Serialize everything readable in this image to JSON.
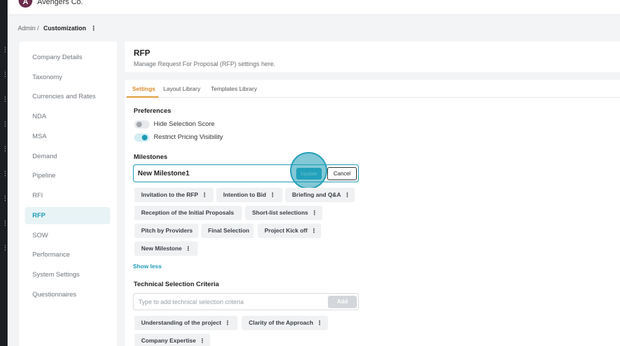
{
  "app": {
    "company_name": "Avengers Co.",
    "logo_letter": "A"
  },
  "breadcrumb": {
    "root": "Admin /",
    "current": "Customization",
    "menu_glyph": "⋮"
  },
  "sidebar": {
    "items": [
      {
        "label": "Company Details"
      },
      {
        "label": "Taxonomy"
      },
      {
        "label": "Currencies and Rates"
      },
      {
        "label": "NDA"
      },
      {
        "label": "MSA"
      },
      {
        "label": "Demand"
      },
      {
        "label": "Pipeline"
      },
      {
        "label": "RFI"
      },
      {
        "label": "RFP",
        "active": true
      },
      {
        "label": "SOW"
      },
      {
        "label": "Performance"
      },
      {
        "label": "System Settings"
      },
      {
        "label": "Questionnaires"
      }
    ]
  },
  "header": {
    "title": "RFP",
    "subtitle": "Manage Request For Proposal (RFP) settings here."
  },
  "tabs": [
    {
      "label": "Settings",
      "active": true
    },
    {
      "label": "Layout Library"
    },
    {
      "label": "Templates Library"
    }
  ],
  "preferences": {
    "title": "Preferences",
    "toggles": [
      {
        "label": "Hide Selection Score",
        "on": false
      },
      {
        "label": "Restrict Pricing Visibility",
        "on": true
      }
    ]
  },
  "milestones": {
    "title": "Milestones",
    "input_value": "New Milestone1",
    "update_label": "Update",
    "cancel_label": "Cancel",
    "chips": [
      "Invitation to the RFP",
      "Intention to Bid",
      "Briefing and Q&A",
      "Reception of the Initial Proposals",
      "Short-list selections",
      "Pitch by Providers",
      "Final Selection",
      "Project Kick off",
      "New Milestone"
    ],
    "show_less_label": "Show less"
  },
  "technical_criteria": {
    "title": "Technical Selection Criteria",
    "placeholder": "Type to add technical selection criteria",
    "add_label": "Add",
    "chips": [
      "Understanding of the project",
      "Clarity of the Approach",
      "Company Expertise"
    ]
  },
  "colors": {
    "accent": "#1b9bb4",
    "tab_accent": "#e09a3b",
    "rail": "#1b1f24"
  },
  "icons": {
    "chip_menu": "vertical-ellipsis-icon",
    "rail_menu": "vertical-ellipsis-icon"
  }
}
